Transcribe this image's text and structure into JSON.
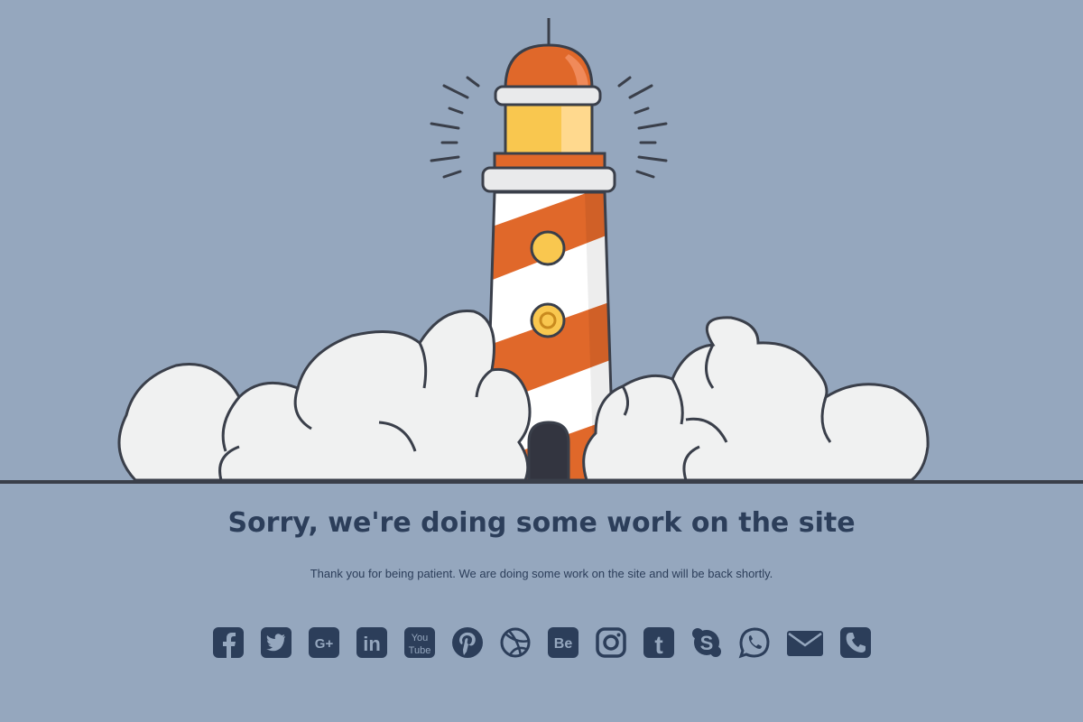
{
  "heading": "Sorry, we're doing some work on the site",
  "message": "Thank you for being patient. We are doing some work on the site and will be back shortly.",
  "colors": {
    "background": "#95a7be",
    "text": "#2c3e5a",
    "lighthouse_orange": "#e0682a",
    "lighthouse_light": "#f9c74f",
    "cloud": "#f0f1f1",
    "outline": "#3a3f4a"
  },
  "social_links": [
    {
      "name": "facebook",
      "icon": "facebook-icon"
    },
    {
      "name": "twitter",
      "icon": "twitter-icon"
    },
    {
      "name": "google-plus",
      "icon": "google-plus-icon",
      "label": "G+"
    },
    {
      "name": "linkedin",
      "icon": "linkedin-icon",
      "label": "in"
    },
    {
      "name": "youtube",
      "icon": "youtube-icon",
      "label_top": "You",
      "label_bottom": "Tube"
    },
    {
      "name": "pinterest",
      "icon": "pinterest-icon"
    },
    {
      "name": "dribbble",
      "icon": "dribbble-icon"
    },
    {
      "name": "behance",
      "icon": "behance-icon",
      "label": "Be"
    },
    {
      "name": "instagram",
      "icon": "instagram-icon"
    },
    {
      "name": "tumblr",
      "icon": "tumblr-icon",
      "label": "t"
    },
    {
      "name": "skype",
      "icon": "skype-icon",
      "label": "S"
    },
    {
      "name": "whatsapp",
      "icon": "whatsapp-icon"
    },
    {
      "name": "email",
      "icon": "email-icon"
    },
    {
      "name": "phone",
      "icon": "phone-icon"
    }
  ]
}
